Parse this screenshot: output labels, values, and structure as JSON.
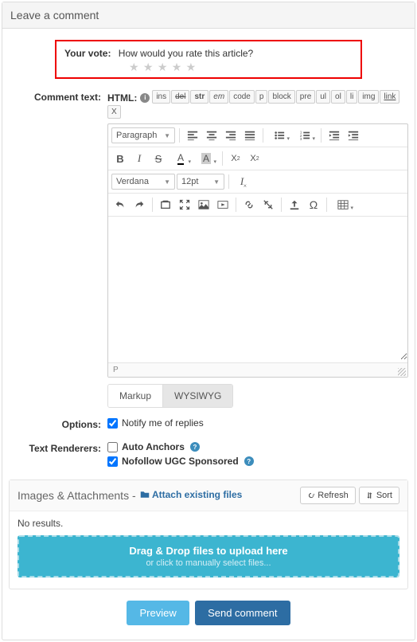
{
  "panel": {
    "title": "Leave a comment"
  },
  "vote": {
    "label": "Your vote:",
    "question": "How would you rate this article?"
  },
  "labels": {
    "comment_text": "Comment text:",
    "options": "Options:",
    "text_renderers": "Text Renderers:"
  },
  "html_tags": {
    "prefix": "HTML:",
    "items": [
      "ins",
      "del",
      "str",
      "em",
      "code",
      "p",
      "block",
      "pre",
      "ul",
      "ol",
      "li",
      "img",
      "link",
      "X"
    ]
  },
  "editor": {
    "paragraph": "Paragraph",
    "font": "Verdana",
    "size": "12pt",
    "status": "P"
  },
  "tabs": {
    "markup": "Markup",
    "wysiwyg": "WYSIWYG"
  },
  "options": {
    "notify": "Notify me of replies"
  },
  "renderers": {
    "auto_anchors": "Auto Anchors",
    "nofollow": "Nofollow UGC Sponsored"
  },
  "attach": {
    "title": "Images & Attachments -",
    "link": "Attach existing files",
    "refresh": "Refresh",
    "sort": "Sort",
    "noresults": "No results.",
    "dz_title": "Drag & Drop files to upload here",
    "dz_sub": "or click to manually select files..."
  },
  "actions": {
    "preview": "Preview",
    "send": "Send comment"
  }
}
